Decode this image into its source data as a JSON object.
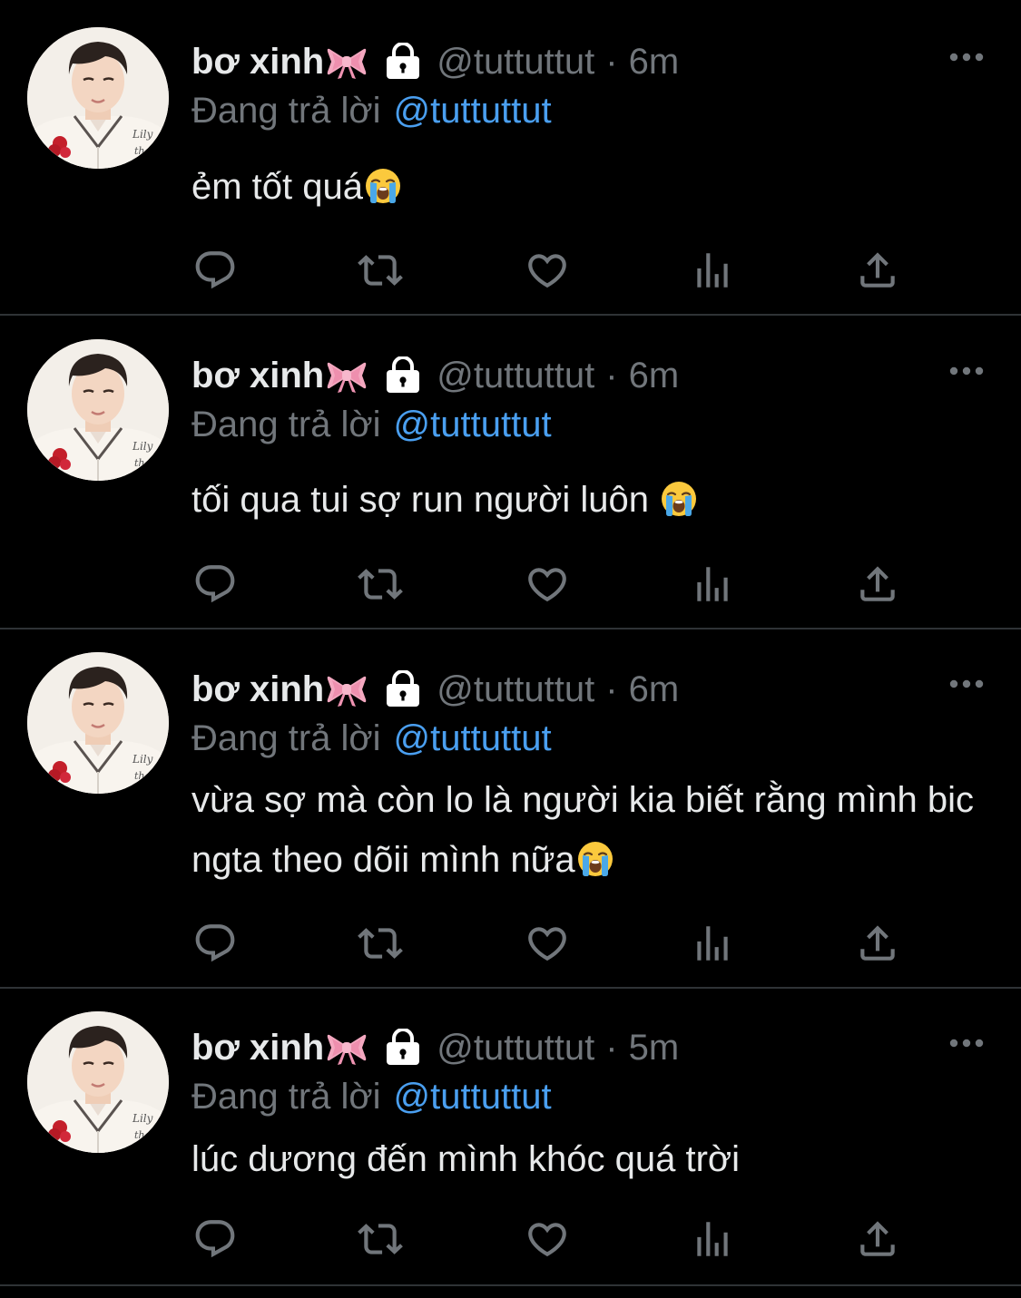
{
  "tweets": [
    {
      "name": "bơ xinh",
      "handle": "@tuttuttut",
      "dot": "·",
      "time": "6m",
      "reply_label": "Đang trả lời",
      "reply_handle": "@tuttuttut",
      "text": "ẻm tốt quá"
    },
    {
      "name": "bơ xinh",
      "handle": "@tuttuttut",
      "dot": "·",
      "time": "6m",
      "reply_label": "Đang trả lời",
      "reply_handle": "@tuttuttut",
      "text": "tối qua tui sợ run người luôn "
    },
    {
      "name": "bơ xinh",
      "handle": "@tuttuttut",
      "dot": "·",
      "time": "6m",
      "reply_label": "Đang trả lời",
      "reply_handle": "@tuttuttut",
      "text": "vừa sợ mà còn lo là người kia biết rằng mình bic ngta theo dõii mình nữa"
    },
    {
      "name": "bơ xinh",
      "handle": "@tuttuttut",
      "dot": "·",
      "time": "5m",
      "reply_label": "Đang trả lời",
      "reply_handle": "@tuttuttut",
      "text": "lúc dương đến mình khóc quá trời"
    }
  ],
  "icons": {
    "name_emoji": "ribbon-icon",
    "protected": "lock-icon",
    "text_emoji": "crying-face-icon",
    "more": "more-icon",
    "actions": [
      "reply-icon",
      "retweet-icon",
      "like-icon",
      "views-icon",
      "share-icon"
    ]
  },
  "colors": {
    "background": "#000000",
    "text": "#e7e9ea",
    "muted": "#71767b",
    "link": "#4a9ff0",
    "separator": "#2f3336"
  }
}
